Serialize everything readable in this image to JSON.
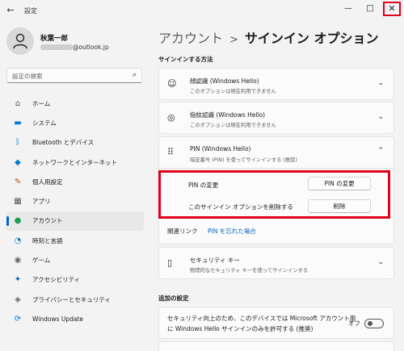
{
  "window": {
    "title": "設定",
    "back_icon": "←",
    "min_icon": "—",
    "max_icon": "□",
    "close_icon": "✕"
  },
  "user": {
    "name": "秋葉一郎",
    "email": "@outlook.jp"
  },
  "search": {
    "placeholder": "設定の検索"
  },
  "nav": [
    {
      "label": "ホーム",
      "icon": "⌂",
      "color": "#555555"
    },
    {
      "label": "システム",
      "icon": "▬",
      "color": "#0078d4"
    },
    {
      "label": "Bluetooth とデバイス",
      "icon": "ᛒ",
      "color": "#0078d4"
    },
    {
      "label": "ネットワークとインターネット",
      "icon": "◆",
      "color": "#0078d4"
    },
    {
      "label": "個人用設定",
      "icon": "✎",
      "color": "#c05010"
    },
    {
      "label": "アプリ",
      "icon": "▦",
      "color": "#555555"
    },
    {
      "label": "アカウント",
      "icon": "●",
      "color": "#1f9d55"
    },
    {
      "label": "時刻と言語",
      "icon": "◔",
      "color": "#0078d4"
    },
    {
      "label": "ゲーム",
      "icon": "◉",
      "color": "#666666"
    },
    {
      "label": "アクセシビリティ",
      "icon": "✦",
      "color": "#0067c0"
    },
    {
      "label": "プライバシーとセキュリティ",
      "icon": "◈",
      "color": "#666666"
    },
    {
      "label": "Windows Update",
      "icon": "⟳",
      "color": "#0078d4"
    }
  ],
  "breadcrumb": {
    "parent": "アカウント",
    "separator": ">",
    "current": "サインイン オプション"
  },
  "signin_header": "サインインする方法",
  "methods": [
    {
      "title": "顔認識 (Windows Hello)",
      "subtitle": "このオプションは現在利用できません",
      "icon": "☺"
    },
    {
      "title": "指紋認識 (Windows Hello)",
      "subtitle": "このオプションは現在利用できません",
      "icon": "◎"
    },
    {
      "title": "PIN (Windows Hello)",
      "subtitle": "暗証番号 (PIN) を使ってサインインする (推奨)",
      "icon": "⠿"
    }
  ],
  "pin": {
    "change_label": "PIN の変更",
    "change_button": "PIN の変更",
    "remove_label": "このサインイン オプションを削除する",
    "remove_button": "削除",
    "related_label": "関連リンク",
    "forgot_link": "PIN を忘れた場合"
  },
  "security_key": {
    "title": "セキュリティ キー",
    "subtitle": "物理的なセキュリティ キーを使ってサインインする",
    "icon": "▯"
  },
  "additional_header": "追加の設定",
  "hello_only": {
    "text_line1": "セキュリティ向上のため、このデバイスでは Microsoft アカウント用",
    "text_line2": "に Windows Hello サインインのみを許可する (推奨)",
    "state": "オフ"
  }
}
